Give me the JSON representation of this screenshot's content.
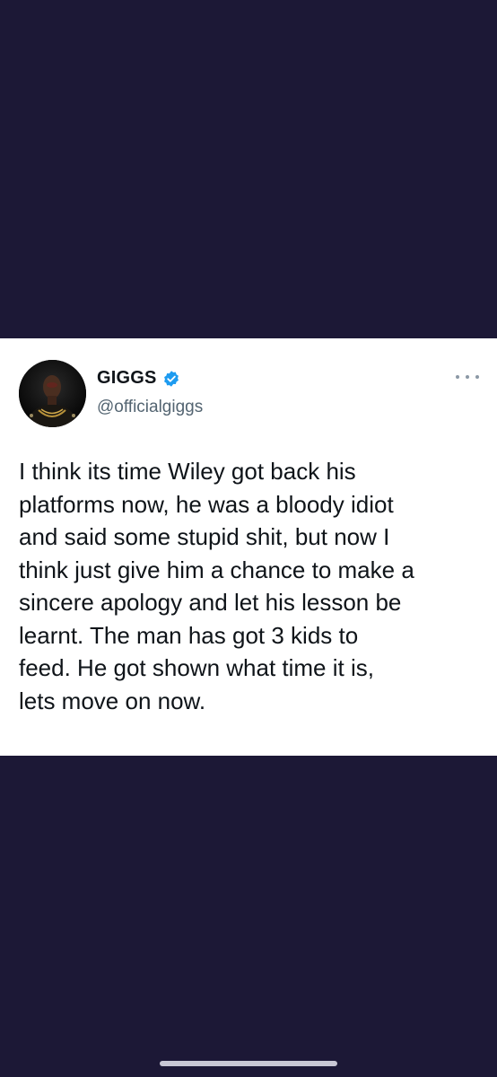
{
  "tweet": {
    "display_name": "GIGGS",
    "handle": "@officialgiggs",
    "text": "I think its time Wiley got back his\nplatforms now, he was a bloody idiot\nand said some stupid shit, but now I\nthink just give him a chance to make a\nsincere apology and let his lesson be\nlearnt. The man has got 3 kids to\nfeed. He got shown what time it is,\nlets move on now.",
    "verified_icon": "verified-badge-icon",
    "more_icon": "more-options-icon"
  },
  "colors": {
    "background": "#1c1836",
    "card": "#ffffff",
    "text_primary": "#0f1419",
    "text_secondary": "#536471",
    "verified": "#1d9bf0"
  }
}
